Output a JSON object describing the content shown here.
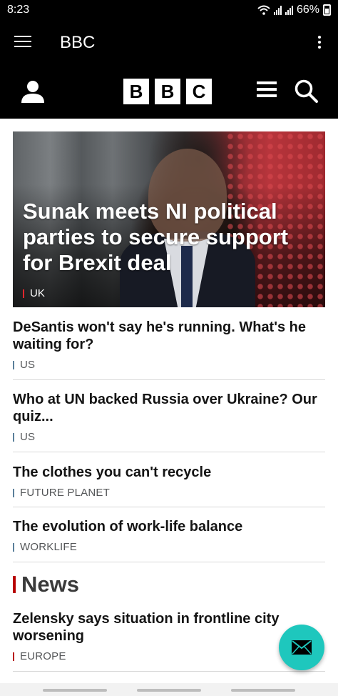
{
  "status_bar": {
    "time": "8:23",
    "battery": "66%"
  },
  "app_bar": {
    "title": "BBC"
  },
  "header": {
    "logo_letters": [
      "B",
      "B",
      "C"
    ]
  },
  "hero": {
    "title": "Sunak meets NI political parties to secure support for Brexit deal",
    "tag": "UK",
    "tag_color": "#b80000"
  },
  "stories": [
    {
      "title": "DeSantis won't say he's running. What's he waiting for?",
      "tag": "US",
      "tag_color": "#5a7f9a"
    },
    {
      "title": "Who at UN backed Russia over Ukraine? Our quiz...",
      "tag": "US",
      "tag_color": "#5a7f9a"
    },
    {
      "title": "The clothes you can't recycle",
      "tag": "FUTURE PLANET",
      "tag_color": "#5a7f9a"
    },
    {
      "title": "The evolution of work-life balance",
      "tag": "WORKLIFE",
      "tag_color": "#5a7f9a"
    }
  ],
  "news_section": {
    "title": "News",
    "stories": [
      {
        "title": "Zelensky says situation in frontline city worsening",
        "tag": "EUROPE",
        "tag_color": "#b80000"
      }
    ]
  },
  "icons": {
    "menu": "hamburger-icon",
    "overflow": "more-vert-icon",
    "account": "account-icon",
    "sections": "sections-menu-icon",
    "search": "search-icon",
    "fab": "mail-icon"
  },
  "colors": {
    "accent_red": "#b80000",
    "fab": "#1ec7bd",
    "header_bg": "#000000"
  }
}
